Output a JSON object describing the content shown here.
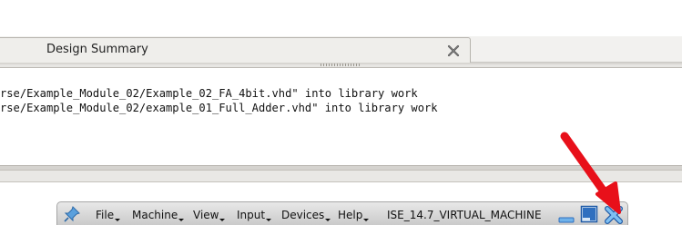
{
  "tab": {
    "label": "Design Summary",
    "close_icon": "close-x-icon"
  },
  "console": {
    "lines": [
      "rse/Example_Module_02/Example_02_FA_4bit.vhd\" into library work",
      "rse/Example_Module_02/example_01_Full_Adder.vhd\" into library work"
    ]
  },
  "mini_toolbar": {
    "pin_icon": "pin-icon",
    "menus": [
      "File",
      "Machine",
      "View",
      "Input",
      "Devices",
      "Help"
    ],
    "vm_name": "ISE_14.7_VIRTUAL_MACHINE",
    "minimize_icon": "minimize-icon",
    "restore_icon": "restore-window-icon",
    "close_icon": "close-icon"
  },
  "annotation": {
    "icon": "red-arrow-icon",
    "color": "#e8101a"
  },
  "colors": {
    "toolbar_close_blue": "#3d8fd6",
    "toolbar_button_blue": "#2f6fbf"
  }
}
